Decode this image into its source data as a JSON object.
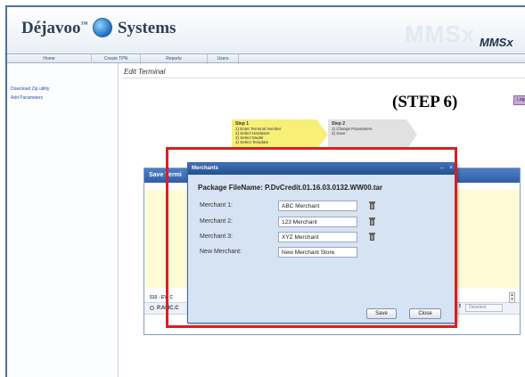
{
  "app": {
    "logo_prefix": "Déjavoo",
    "logo_sup": "™",
    "logo_suffix": "Systems",
    "watermark": "MMSx",
    "product": "MMSx"
  },
  "nav": {
    "items": [
      "Home",
      "Create TPN",
      "Reports",
      "Users"
    ]
  },
  "sidebar": {
    "links": [
      "Download Zip utility",
      "Add Parameters"
    ]
  },
  "breadcrumb": "Edit Terminal",
  "step_annotation": "(STEP 6)",
  "logout_label": "Logo",
  "steps": [
    {
      "title": "Step 1",
      "lines": [
        "1) Enter Terminal Number",
        "2) Select Hardware",
        "3) Select Model",
        "4) Select Template"
      ]
    },
    {
      "title": "Step 2",
      "lines": [
        "1) Change Parameters",
        "2) Save"
      ]
    }
  ],
  "save_panel": {
    "title": "Save Termi",
    "row_label": "510 - EV_C",
    "row_item": "P.AMC.C",
    "select_value": "Deselect",
    "suffix": "t"
  },
  "dialog": {
    "title": "Merchants",
    "minimize": "–",
    "close": "×",
    "package_label": "Package FileName:",
    "package_value": "P.DvCredit.01.16.03.0132.WW00.tar",
    "merchants": [
      {
        "label": "Merchant 1:",
        "value": "ABC Merchant",
        "deletable": true
      },
      {
        "label": "Merchant 2:",
        "value": "123 Merchant",
        "deletable": true
      },
      {
        "label": "Merchant 3:",
        "value": "XYZ Merchant",
        "deletable": true
      },
      {
        "label": "New Merchant:",
        "value": "New Merchant Store",
        "deletable": false
      }
    ],
    "save_label": "Save",
    "close_label": "Close"
  },
  "colors": {
    "highlight": "#d82020",
    "dialog_title": "#2f5ea6",
    "step1": "#f7ef78"
  }
}
